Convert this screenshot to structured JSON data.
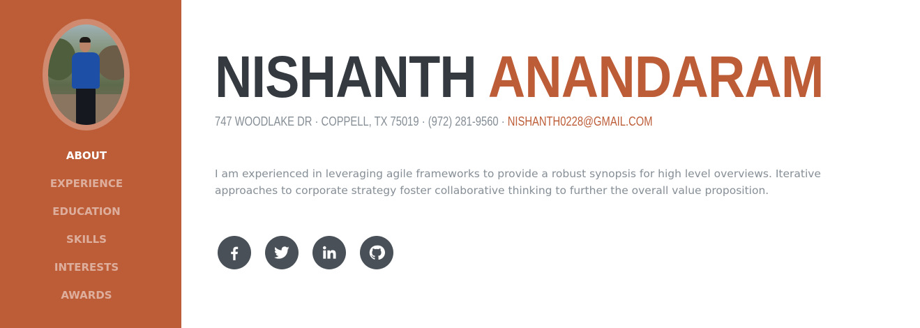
{
  "profile": {
    "first_name": "NISHANTH",
    "last_name": "ANANDARAM",
    "address": "747 WOODLAKE DR · COPPELL, TX 75019 · (972) 281-9560 ·",
    "email": "NISHANTH0228@GMAIL.COM",
    "bio": "I am experienced in leveraging agile frameworks to provide a robust synopsis for high level overviews. Iterative approaches to corporate strategy foster collaborative thinking to further the overall value proposition."
  },
  "nav": {
    "items": [
      {
        "label": "ABOUT",
        "active": true
      },
      {
        "label": "EXPERIENCE",
        "active": false
      },
      {
        "label": "EDUCATION",
        "active": false
      },
      {
        "label": "SKILLS",
        "active": false
      },
      {
        "label": "INTERESTS",
        "active": false
      },
      {
        "label": "AWARDS",
        "active": false
      }
    ]
  },
  "social": [
    {
      "icon": "facebook-icon"
    },
    {
      "icon": "twitter-icon"
    },
    {
      "icon": "linkedin-icon"
    },
    {
      "icon": "github-icon"
    }
  ],
  "colors": {
    "primary": "#bd5d38",
    "dark": "#343a40",
    "muted": "#868e96",
    "icon_bg": "#495057"
  }
}
